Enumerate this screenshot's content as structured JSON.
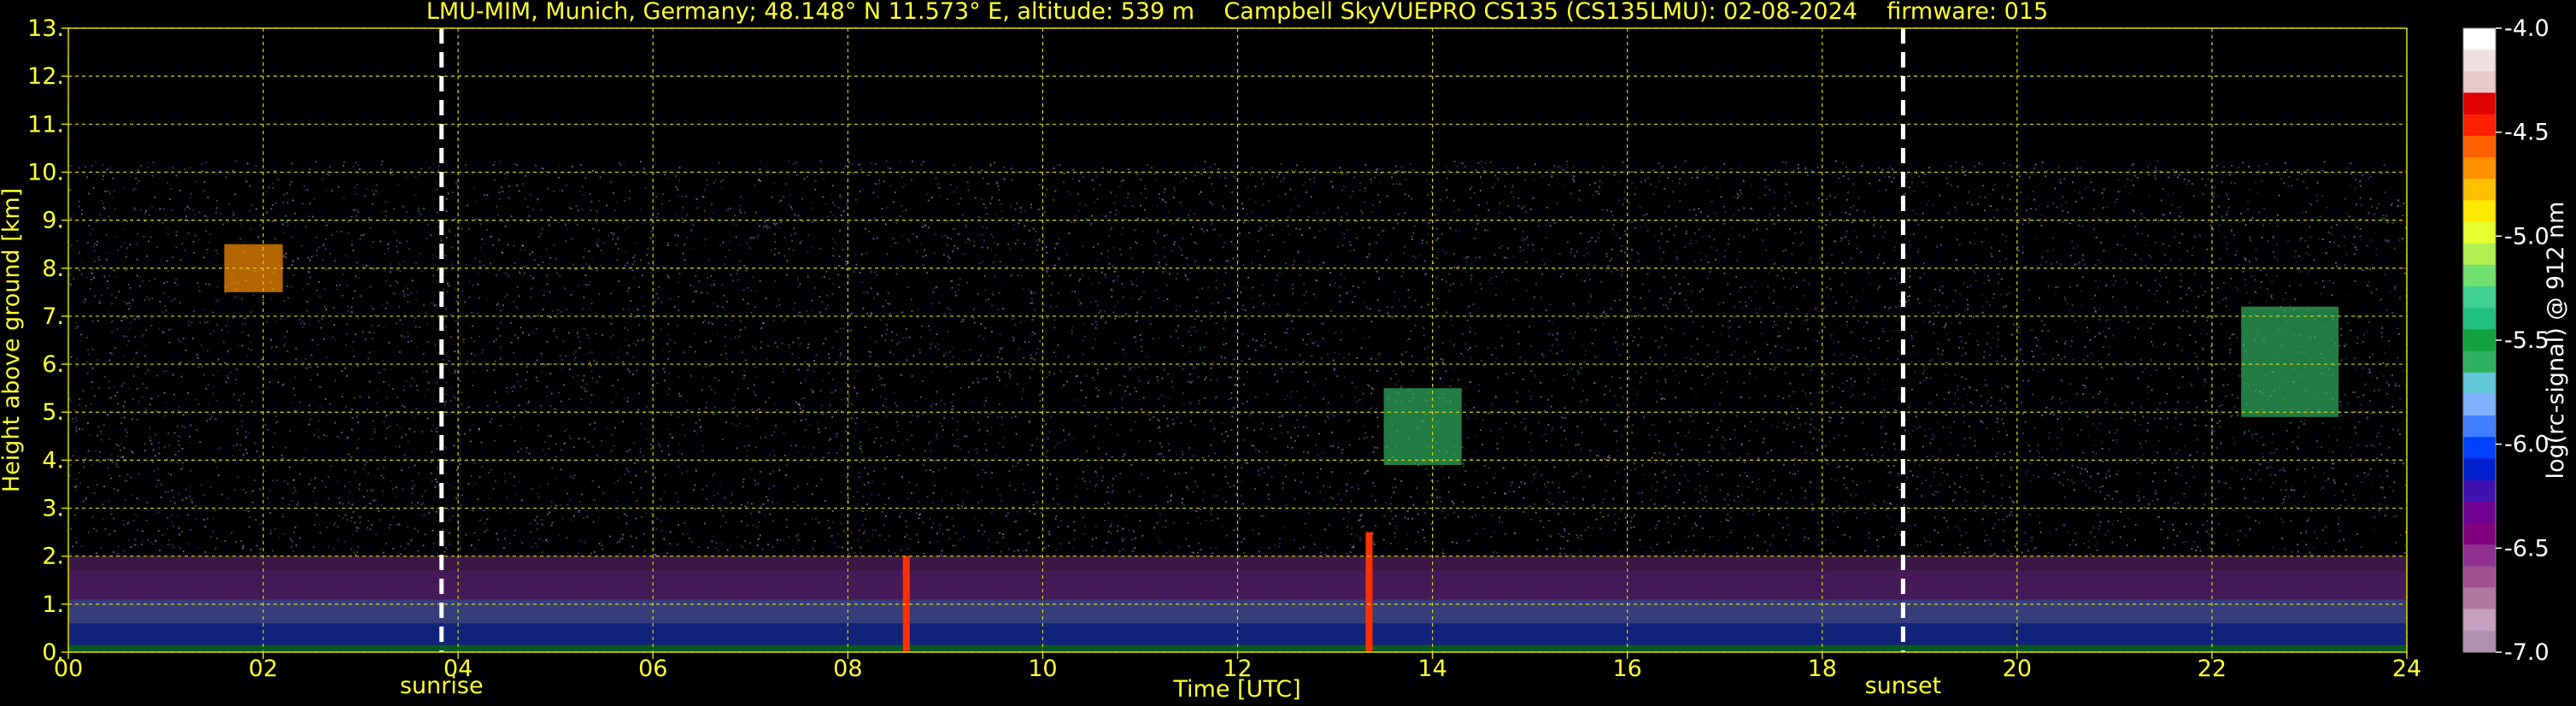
{
  "chart_data": {
    "type": "heatmap",
    "title": "LMU-MIM, Munich, Germany; 48.148° N 11.573° E, altitude: 539 m    Campbell SkyVUEPRO CS135 (CS135LMU): 02-08-2024    firmware: 015",
    "xlabel": "Time [UTC]",
    "ylabel": "Height above ground [km]",
    "xlim": [
      0,
      24
    ],
    "ylim": [
      0,
      13
    ],
    "x_ticks": [
      0,
      2,
      4,
      6,
      8,
      10,
      12,
      14,
      16,
      18,
      20,
      22,
      24
    ],
    "x_tick_labels": [
      "00",
      "02",
      "04",
      "06",
      "08",
      "10",
      "12",
      "14",
      "16",
      "18",
      "20",
      "22",
      "24"
    ],
    "y_ticks": [
      0,
      1,
      2,
      3,
      4,
      5,
      6,
      7,
      8,
      9,
      10,
      11,
      12,
      13
    ],
    "y_tick_labels": [
      "0.",
      "1.",
      "2.",
      "3.",
      "4.",
      "5.",
      "6.",
      "7.",
      "8.",
      "9.",
      "10.",
      "11.",
      "12.",
      "13."
    ],
    "grid": true,
    "signal_top_km": 10.25,
    "colorbar": {
      "label": "log(rc-signal) @ 912 nm",
      "range": [
        -7.0,
        -4.0
      ],
      "ticks": [
        -4.0,
        -4.5,
        -5.0,
        -5.5,
        -6.0,
        -6.5,
        -7.0
      ],
      "tick_labels": [
        "-4.0",
        "-4.5",
        "-5.0",
        "-5.5",
        "-6.0",
        "-6.5",
        "-7.0"
      ],
      "colors": [
        "#ffffff",
        "#f0e0e0",
        "#e8c8c8",
        "#e00000",
        "#ff2000",
        "#ff6000",
        "#ff9000",
        "#ffc000",
        "#ffe800",
        "#e8ff30",
        "#b0f050",
        "#70e070",
        "#40d090",
        "#20c080",
        "#10a040",
        "#30b060",
        "#60c8d8",
        "#80b0ff",
        "#4080ff",
        "#0040ff",
        "#0020d0",
        "#4010b0",
        "#700090",
        "#800080",
        "#903090",
        "#a05090",
        "#b078a0",
        "#c8a0c0",
        "#b090b0"
      ]
    },
    "vlines": [
      {
        "x": 3.83,
        "label": "sunrise"
      },
      {
        "x": 18.83,
        "label": "sunset"
      }
    ],
    "features": [
      {
        "name": "boundary layer aerosol",
        "x_range": [
          0,
          24
        ],
        "height_km": [
          0.1,
          2.0
        ]
      },
      {
        "name": "cirrus cloud",
        "x_range": [
          1.6,
          2.2
        ],
        "height_km": [
          7.5,
          8.5
        ]
      },
      {
        "name": "cloud",
        "x_range": [
          13.5,
          14.3
        ],
        "height_km": [
          3.9,
          5.5
        ]
      },
      {
        "name": "cloud",
        "x_range": [
          22.3,
          23.3
        ],
        "height_km": [
          4.9,
          7.2
        ]
      },
      {
        "name": "rain shaft",
        "x": 8.6,
        "height_km": [
          0,
          2.0
        ]
      },
      {
        "name": "rain shaft",
        "x": 13.35,
        "height_km": [
          0,
          2.5
        ]
      }
    ]
  }
}
